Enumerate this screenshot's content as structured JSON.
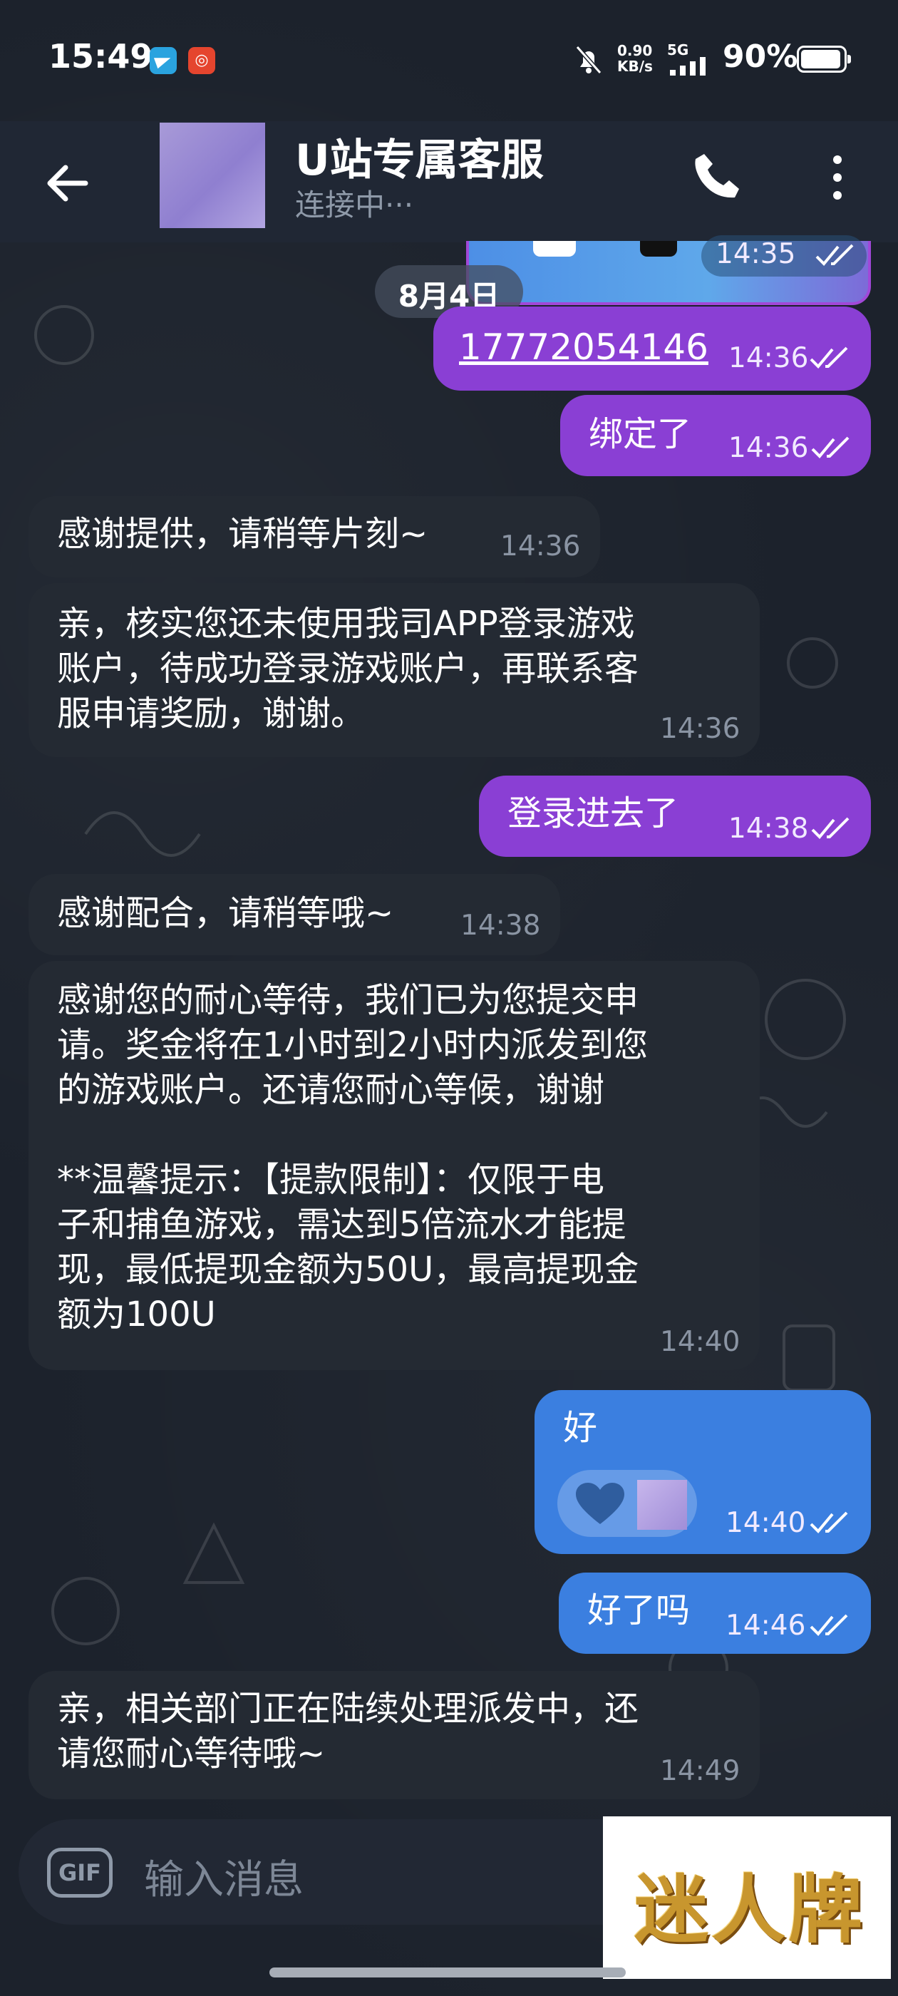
{
  "status_bar": {
    "time": "15:49",
    "net_speed_value": "0.90",
    "net_speed_unit": "KB/s",
    "network": "5G",
    "battery": "90%",
    "notification_icons": [
      "telegram-icon",
      "app-notification-icon"
    ]
  },
  "header": {
    "title": "U站专属客服",
    "status": "连接中···"
  },
  "date_separator": "8月4日",
  "previous_message_time": "14:35",
  "messages": [
    {
      "side": "out",
      "color": "#8a3fd4",
      "text": "17772054146",
      "time": "14:36",
      "link": true
    },
    {
      "side": "out",
      "color": "#8a3fd4",
      "text": "绑定了",
      "time": "14:36"
    },
    {
      "side": "in",
      "text": "感谢提供，请稍等片刻~",
      "time": "14:36"
    },
    {
      "side": "in",
      "text": "亲，核实您还未使用我司APP登录游戏\n账户，待成功登录游戏账户，再联系客\n服申请奖励，谢谢。",
      "time": "14:36"
    },
    {
      "side": "out",
      "color": "#8a3fd4",
      "text": "登录进去了",
      "time": "14:38"
    },
    {
      "side": "in",
      "text": "感谢配合，请稍等哦~",
      "time": "14:38"
    },
    {
      "side": "in",
      "text": "感谢您的耐心等待，我们已为您提交申\n请。奖金将在1小时到2小时内派发到您\n的游戏账户。还请您耐心等候，谢谢\n\n**温馨提示：【提款限制】：仅限于电\n子和捕鱼游戏，需达到5倍流水才能提\n现，最低提现金额为50U，最高提现金\n额为100U",
      "time": "14:40"
    },
    {
      "side": "out",
      "color": "#3b7fe0",
      "text": "好",
      "time": "14:40",
      "reaction": "heart"
    },
    {
      "side": "out",
      "color": "#3b7fe0",
      "text": "好了吗",
      "time": "14:46"
    },
    {
      "side": "in",
      "text": "亲，相关部门正在陆续处理派发中，还\n请您耐心等待哦~",
      "time": "14:49"
    }
  ],
  "input": {
    "gif_label": "GIF",
    "placeholder": "输入消息"
  },
  "watermark_logo": "迷人牌",
  "colors": {
    "background": "#1c222c",
    "incoming_bubble": "#242a33",
    "outgoing_purple": "#8a3fd4",
    "outgoing_blue": "#3b7fe0",
    "header": "#202734"
  }
}
